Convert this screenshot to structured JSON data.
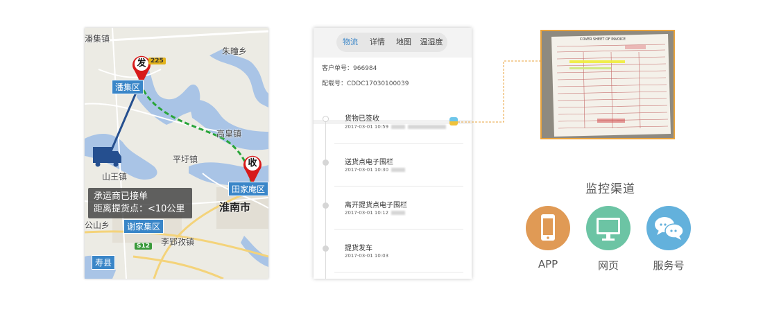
{
  "map": {
    "labels": {
      "panji_town": "潘集镇",
      "zhutuan": "朱疃乡",
      "gaohuang": "高皇镇",
      "pingwei": "平圩镇",
      "shanwang": "山王镇",
      "huainan": "淮南市",
      "gongshan": "公山乡",
      "liying": "李郢孜镇"
    },
    "chips": {
      "panji_district": "潘集区",
      "tianjiaan": "田家庵区",
      "xiejiaji": "谢家集区",
      "shouxian": "寿县"
    },
    "shields": {
      "s225": "225",
      "s12": "S12"
    },
    "pins": {
      "origin": "发",
      "destination": "收"
    },
    "tooltip": {
      "line1": "承运商已接单",
      "line2": "距离提货点：<10公里"
    },
    "colors": {
      "route_done": "#254f8f",
      "route_pending": "#2aa53a",
      "pin": "#d71a1a"
    }
  },
  "tracking": {
    "tabs": [
      "物流",
      "详情",
      "地图",
      "温湿度"
    ],
    "active_tab": "物流",
    "customer_no": "客户单号：966984",
    "shipment_no": "配载号：CDDC17030100039",
    "events": [
      {
        "title": "货物已签收",
        "time": "2017-03-01 10:59"
      },
      {
        "title": "送货点电子围栏",
        "time": "2017-03-01 10:30"
      },
      {
        "title": "离开提货点电子围栏",
        "time": "2017-03-01 10:12"
      },
      {
        "title": "提货发车",
        "time": "2017-03-01 10:03"
      }
    ]
  },
  "receipt": {
    "heading": "COVER SHEET OF INVOICE",
    "accent_color": "#e8a33d"
  },
  "channels": {
    "title": "监控渠道",
    "items": [
      {
        "label": "APP",
        "icon": "phone-icon",
        "color": "#e09a55"
      },
      {
        "label": "网页",
        "icon": "monitor-icon",
        "color": "#6cc4a4"
      },
      {
        "label": "服务号",
        "icon": "chat-icon",
        "color": "#63b1dc"
      }
    ]
  }
}
